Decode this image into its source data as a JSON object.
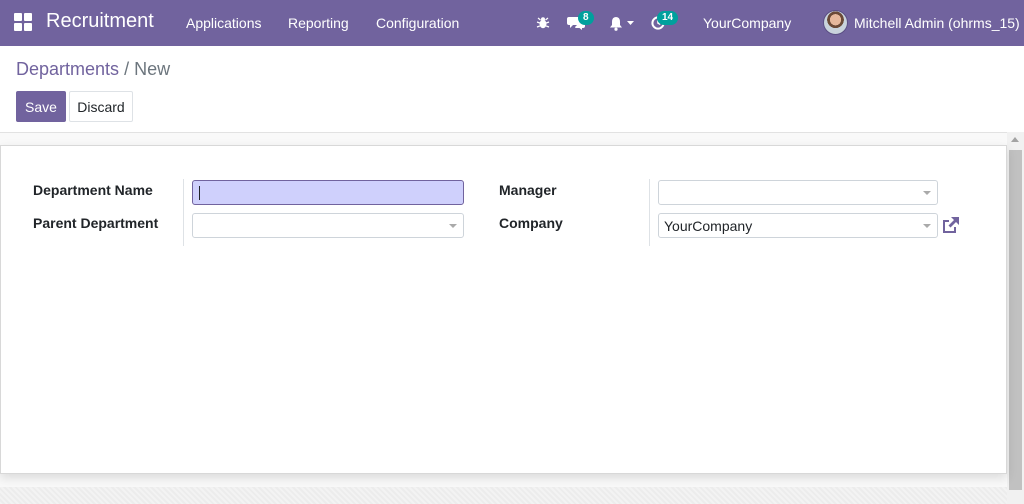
{
  "navbar": {
    "brand": "Recruitment",
    "menus": [
      "Applications",
      "Reporting",
      "Configuration"
    ],
    "messages_count": "8",
    "activities_count": "14",
    "company": "YourCompany",
    "user": "Mitchell Admin (ohrms_15)",
    "icons": [
      "apps-icon",
      "bug-icon",
      "chat-icon",
      "bell-icon",
      "clock-icon"
    ]
  },
  "breadcrumb": {
    "parent": "Departments",
    "separator": "/",
    "current": "New"
  },
  "buttons": {
    "save": "Save",
    "discard": "Discard"
  },
  "form": {
    "department_name_label": "Department Name",
    "department_name_value": "",
    "parent_department_label": "Parent Department",
    "parent_department_value": "",
    "manager_label": "Manager",
    "manager_value": "",
    "company_label": "Company",
    "company_value": "YourCompany"
  },
  "colors": {
    "brand": "#71639e",
    "badge": "#00a09d",
    "focus_input": "#cfd0fc"
  }
}
